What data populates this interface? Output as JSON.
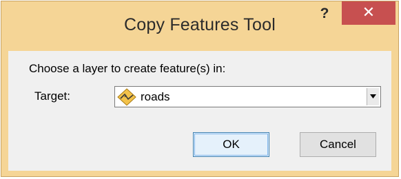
{
  "window": {
    "title": "Copy Features Tool",
    "help_label": "?",
    "close_label": "✕"
  },
  "dialog": {
    "prompt": "Choose a layer to create feature(s) in:",
    "target_label": "Target:",
    "target_value": "roads",
    "target_icon": "line-layer-icon"
  },
  "buttons": {
    "ok_label": "OK",
    "cancel_label": "Cancel"
  },
  "colors": {
    "frame": "#f5d596",
    "close_button": "#c75050",
    "client_background": "#f0f0f0"
  }
}
